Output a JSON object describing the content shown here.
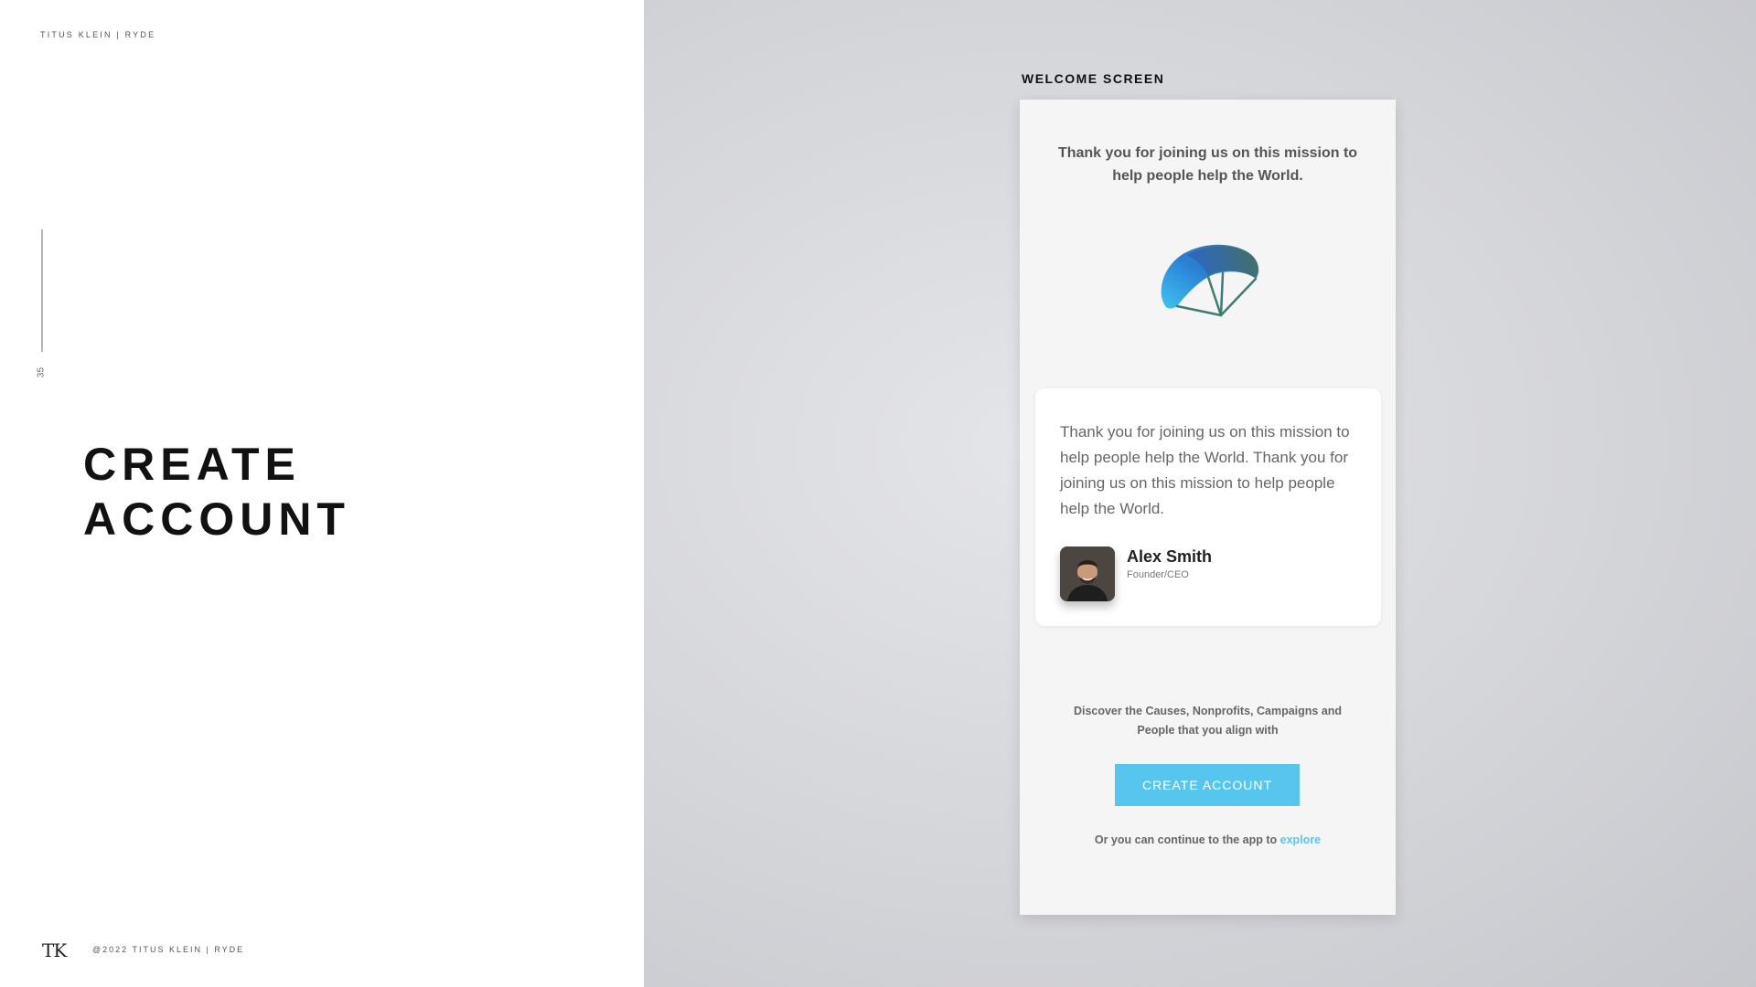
{
  "header": {
    "brand": "TITUS KLEIN | RYDE"
  },
  "page_number": "35",
  "title": {
    "line1": "CREATE",
    "line2": "ACCOUNT"
  },
  "footer": {
    "logo": "TK",
    "copyright": "@2022 TITUS KLEIN | RYDE"
  },
  "screen": {
    "label": "WELCOME SCREEN",
    "heading": "Thank you for joining us on this mission to help people help the World.",
    "quote": "Thank you for joining us on this mission to help people help the World. Thank you for joining us on this mission to help people help the World.",
    "person": {
      "name": "Alex Smith",
      "role": "Founder/CEO"
    },
    "discover_text": "Discover the Causes, Nonprofits, Campaigns and People that you align with",
    "cta_label": "CREATE ACCOUNT",
    "explore_prefix": "Or you can continue to the app to ",
    "explore_link": "explore"
  },
  "colors": {
    "accent": "#56c6ef",
    "logo_blue": "#2a7fd4",
    "logo_green": "#4a8a80"
  },
  "icons": {
    "app_logo": "parachute-logo",
    "avatar": "person-photo"
  }
}
